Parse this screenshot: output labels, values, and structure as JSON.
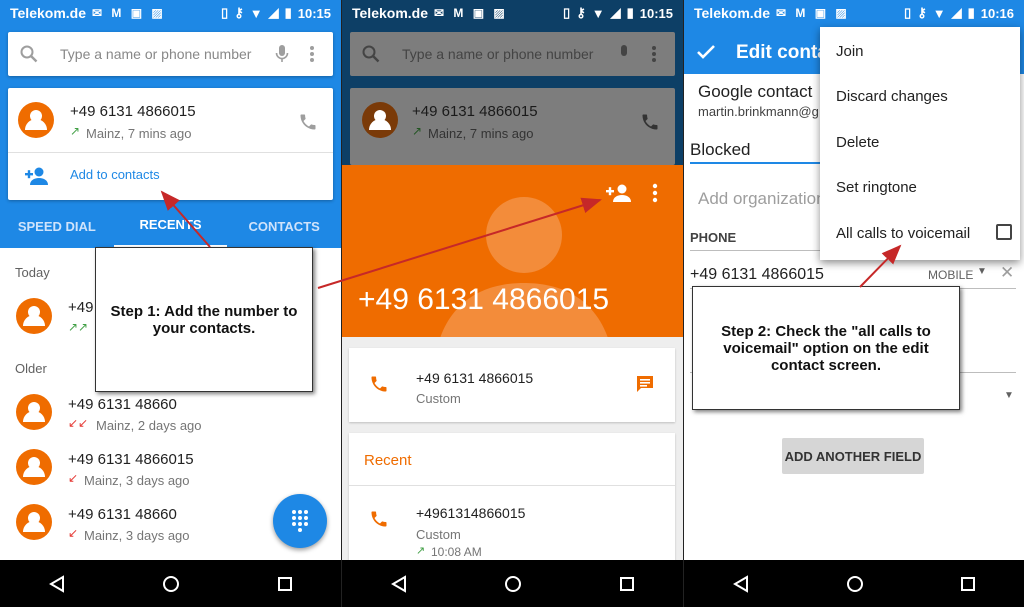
{
  "panel1": {
    "status": {
      "carrier": "Telekom.de",
      "time": "10:15"
    },
    "search_placeholder": "Type a name or phone number",
    "top_card": {
      "number": "+49 6131 4866015",
      "detail": "Mainz, 7 mins ago",
      "add_label": "Add to contacts"
    },
    "tabs": [
      "SPEED DIAL",
      "RECENTS",
      "CONTACTS"
    ],
    "today_label": "Today",
    "today_item": {
      "number": "+49 6131 4866015"
    },
    "older_label": "Older",
    "older_items": [
      {
        "number": "+49 6131 48660",
        "detail": "Mainz, 2 days ago"
      },
      {
        "number": "+49 6131 4866015",
        "detail": "Mainz, 3 days ago"
      },
      {
        "number": "+49 6131 48660",
        "detail": "Mainz, 3 days ago"
      }
    ],
    "callout": "Step 1: Add the number to your contacts."
  },
  "panel2": {
    "status": {
      "carrier": "Telekom.de",
      "time": "10:15"
    },
    "search_placeholder": "Type a name or phone number",
    "card": {
      "number": "+49 6131 4866015",
      "detail": "Mainz, 7 mins ago"
    },
    "hero_number": "+49 6131 4866015",
    "phone_entry": {
      "number": "+49 6131 4866015",
      "type": "Custom"
    },
    "recent_label": "Recent",
    "recent_entry": {
      "number": "+4961314866015",
      "type": "Custom",
      "time": "10:08 AM"
    }
  },
  "panel3": {
    "status": {
      "carrier": "Telekom.de",
      "time": "10:16"
    },
    "title": "Edit conta",
    "account_label": "Google contact",
    "account_email": "martin.brinkmann@g",
    "name_value": "Blocked",
    "org_placeholder": "Add organization",
    "phone_section": "PHONE",
    "phone_value": "+49 6131 4866015",
    "phone_type": "MOBILE",
    "menu": [
      "Join",
      "Discard changes",
      "Delete",
      "Set ringtone",
      "All calls to voicemail"
    ],
    "add_field_button": "ADD ANOTHER FIELD",
    "callout": "Step 2: Check the \"all calls to voicemail\" option on the edit contact screen."
  },
  "colors": {
    "accent_blue": "#1e88e5",
    "orange": "#ef6c00",
    "arrow_red": "#c62828"
  }
}
